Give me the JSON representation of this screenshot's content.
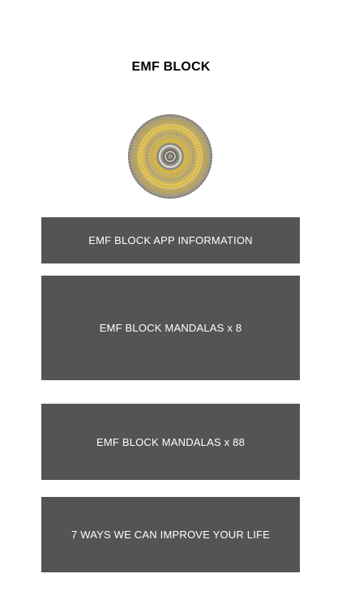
{
  "header": {
    "title": "EMF BLOCK"
  },
  "logo": {
    "icon": "mandala-icon",
    "colors": {
      "gold": "#d8b84a",
      "grey": "#9a9a92",
      "dark": "#6c6a5f",
      "light": "#d9d7cc"
    }
  },
  "menu": {
    "items": [
      {
        "label": "EMF BLOCK APP INFORMATION"
      },
      {
        "label": "EMF BLOCK MANDALAS x 8"
      },
      {
        "label": "EMF BLOCK MANDALAS x 88"
      },
      {
        "label": "7 WAYS WE CAN IMPROVE YOUR LIFE"
      }
    ],
    "button_color": "#545454",
    "text_color": "#ffffff"
  }
}
